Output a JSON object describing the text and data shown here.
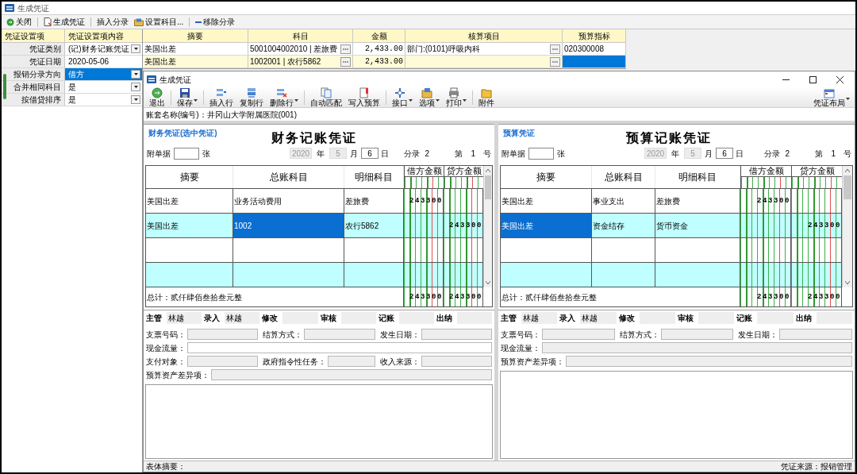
{
  "window": {
    "title": "生成凭证"
  },
  "toolbar": [
    {
      "label": "关闭"
    },
    {
      "label": "生成凭证"
    },
    {
      "label": "插入分录"
    },
    {
      "label": "设置科目..."
    },
    {
      "label": "移除分录"
    }
  ],
  "settings": {
    "columns": [
      "凭证设置项",
      "凭证设置项内容"
    ],
    "rows": [
      {
        "label": "凭证类别",
        "value": "(记)财务记账凭证",
        "dropdown": true,
        "selected": false
      },
      {
        "label": "凭证日期",
        "value": "2020-05-06",
        "dropdown": false,
        "selected": false
      },
      {
        "label": "报销分录方向",
        "value": "借方",
        "dropdown": true,
        "selected": true
      },
      {
        "label": "合并相同科目",
        "value": "是",
        "dropdown": true,
        "selected": false
      },
      {
        "label": "按借贷排序",
        "value": "是",
        "dropdown": true,
        "selected": false
      }
    ]
  },
  "entries": {
    "columns": [
      {
        "label": "摘要",
        "kind": "text"
      },
      {
        "label": "科目",
        "kind": "lookup"
      },
      {
        "label": "金额",
        "kind": "amount"
      },
      {
        "label": "核算项目",
        "kind": "lookup"
      },
      {
        "label": "预算指标",
        "kind": "text"
      }
    ],
    "rows": [
      {
        "selected": false,
        "cells": [
          "美国出差",
          "5001004002010 | 差旅费",
          "2,433.00",
          "部门:(0101)呼吸内科",
          "020300008"
        ]
      },
      {
        "selected": true,
        "cells": [
          "美国出差",
          "1002001 | 农行5862",
          "2,433.00",
          null,
          null
        ]
      }
    ]
  },
  "voucher_window": {
    "title": "生成凭证",
    "toolbar": [
      {
        "label": "退出",
        "menu": false
      },
      {
        "label": "保存",
        "menu": true
      },
      {
        "label": "插入行",
        "menu": false
      },
      {
        "label": "复制行",
        "menu": false
      },
      {
        "label": "删除行",
        "menu": true
      },
      {
        "label": "自动匹配",
        "menu": false
      },
      {
        "label": "写入预算",
        "menu": false
      },
      {
        "label": "接口",
        "menu": true
      },
      {
        "label": "选项",
        "menu": true
      },
      {
        "label": "打印",
        "menu": true
      },
      {
        "label": "附件",
        "menu": false
      }
    ],
    "layout_button": {
      "label": "凭证布局",
      "menu": true
    },
    "account": "账套名称(编号)：井冈山大学附属医院(001)",
    "vouchers": [
      {
        "tag": "财务凭证(选中凭证)",
        "title": "财务记账凭证",
        "attach_label": "附单据",
        "attach_unit": "张",
        "year": "2020",
        "year_label": "年",
        "month": "5",
        "month_label": "月",
        "day": "6",
        "day_label": "日",
        "entries_label": "分录",
        "entries": "2",
        "no_prefix": "第",
        "no": "1",
        "no_suffix": "号",
        "columns": [
          "摘要",
          "总账科目",
          "明细科目",
          "借方金额",
          "贷方金额"
        ],
        "rows": [
          {
            "cells": [
              {
                "text": "美国出差",
                "selected": false
              },
              {
                "text": "业务活动费用",
                "selected": false
              },
              {
                "text": "差旅费",
                "selected": false
              }
            ],
            "debit": "243300"
          },
          {
            "cells": [
              {
                "text": "美国出差",
                "selected": false
              },
              {
                "text": "1002",
                "selected": true
              },
              {
                "text": "农行5862",
                "selected": false
              }
            ],
            "credit": "243300"
          },
          {
            "cells": [
              {
                "selected": false
              },
              {
                "selected": false
              },
              {
                "selected": false
              }
            ]
          },
          {
            "cells": [
              {
                "selected": false
              },
              {
                "selected": false
              },
              {
                "selected": false
              }
            ]
          }
        ],
        "total_label": "总计：贰仟肆佰叁拾叁元整",
        "total_debit": "243300",
        "total_credit": "243300",
        "signatures": [
          {
            "label": "主管",
            "value": "林越"
          },
          {
            "label": "录入",
            "value": "林越"
          },
          {
            "label": "修改"
          },
          {
            "label": "审核"
          },
          {
            "label": "记账"
          },
          {
            "label": "出纳"
          }
        ],
        "fields": [
          [
            {
              "label": "支票号码：",
              "disabled": true
            },
            {
              "label": "结算方式：",
              "disabled": true
            },
            {
              "label": "发生日期：",
              "disabled": true
            }
          ],
          [
            {
              "label": "现金流量：",
              "disabled": false
            }
          ],
          [
            {
              "label": "支付对象：",
              "disabled": true
            },
            {
              "label": "政府指令性任务：",
              "disabled": true
            },
            {
              "label": "收入来源：",
              "disabled": true
            }
          ],
          [
            {
              "label": "预算资产差异项：",
              "disabled": true
            }
          ]
        ]
      },
      {
        "tag": "预算凭证",
        "title": "预算记账凭证",
        "attach_label": "附单据",
        "attach_unit": "张",
        "year": "2020",
        "year_label": "年",
        "month": "5",
        "month_label": "月",
        "day": "6",
        "day_label": "日",
        "entries_label": "分录",
        "entries": "2",
        "no_prefix": "第",
        "no": "1",
        "no_suffix": "号",
        "columns": [
          "摘要",
          "总账科目",
          "明细科目",
          "借方金额",
          "贷方金额"
        ],
        "rows": [
          {
            "cells": [
              {
                "text": "美国出差",
                "selected": false
              },
              {
                "text": "事业支出",
                "selected": false
              },
              {
                "text": "差旅费",
                "selected": false
              }
            ],
            "debit": "243300"
          },
          {
            "cells": [
              {
                "text": "美国出差",
                "selected": true
              },
              {
                "text": "资金结存",
                "selected": false
              },
              {
                "text": "货币资金",
                "selected": false
              }
            ],
            "credit": "243300"
          },
          {
            "cells": [
              {
                "selected": false
              },
              {
                "selected": false
              },
              {
                "selected": false
              }
            ]
          },
          {
            "cells": [
              {
                "selected": false
              },
              {
                "selected": false
              },
              {
                "selected": false
              }
            ]
          }
        ],
        "total_label": "总计：贰仟肆佰叁拾叁元整",
        "total_debit": "243300",
        "total_credit": "243300",
        "signatures": [
          {
            "label": "主管",
            "value": "林越"
          },
          {
            "label": "录入",
            "value": "林越"
          },
          {
            "label": "修改"
          },
          {
            "label": "审核"
          },
          {
            "label": "记账"
          },
          {
            "label": "出纳"
          }
        ],
        "fields": [
          [
            {
              "label": "支票号码：",
              "disabled": true
            },
            {
              "label": "结算方式：",
              "disabled": true
            },
            {
              "label": "发生日期：",
              "disabled": true
            }
          ],
          [
            {
              "label": "现金流量：",
              "disabled": true
            }
          ],
          [
            {
              "label": "预算资产差异项：",
              "disabled": true
            }
          ]
        ]
      }
    ],
    "status_left": "表体摘要：",
    "status_right": "凭证来源：报销管理"
  }
}
